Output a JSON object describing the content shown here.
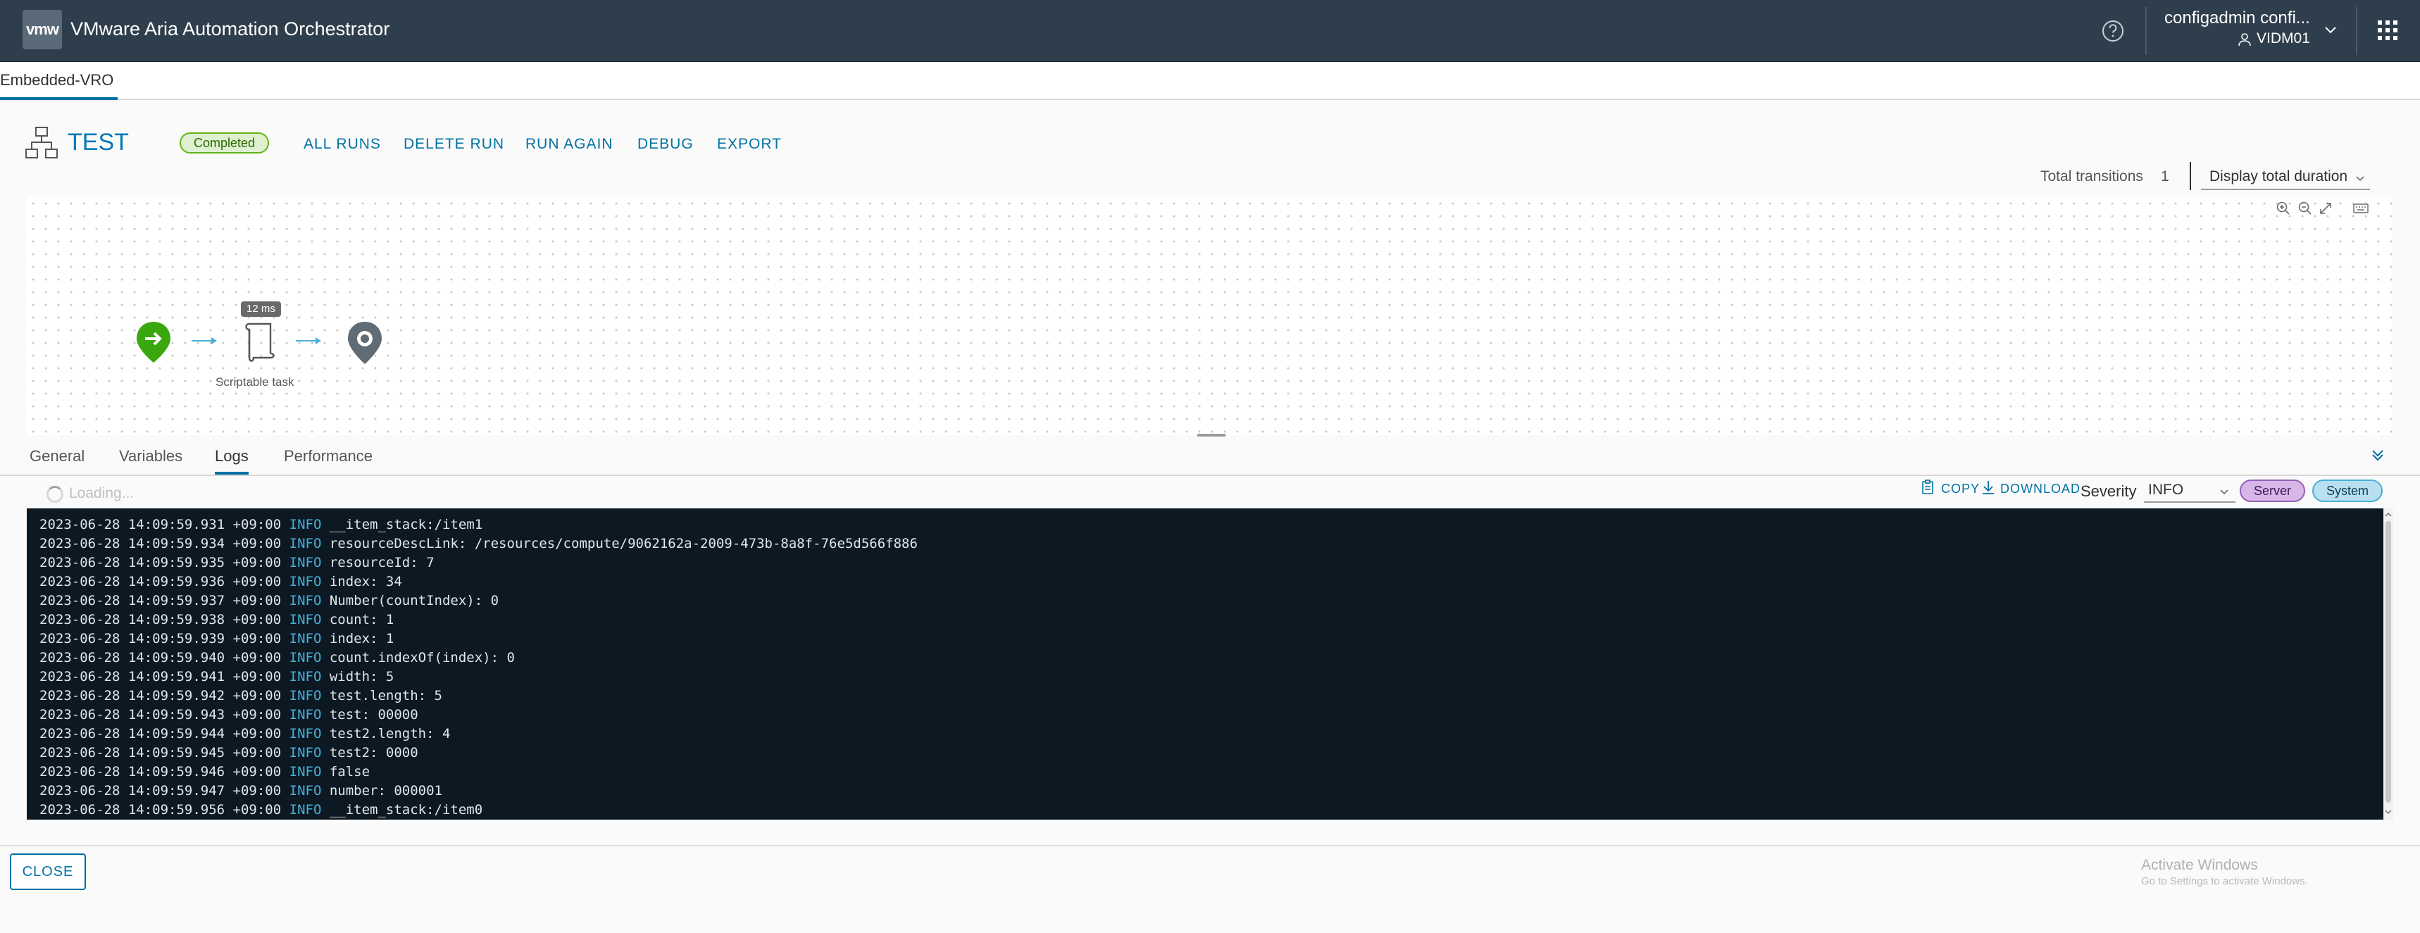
{
  "header": {
    "logo_text": "vmw",
    "app_title": "VMware Aria Automation Orchestrator",
    "user_name": "configadmin confi...",
    "tenant": "VIDM01",
    "icons": [
      "help-icon",
      "user-icon",
      "chevron-down-icon",
      "app-grid-icon"
    ]
  },
  "subnav": {
    "tab_label": "Embedded-VRO"
  },
  "workflow": {
    "title": "TEST",
    "status": "Completed",
    "status_color": "#60b515",
    "actions": [
      "ALL RUNS",
      "DELETE RUN",
      "RUN AGAIN",
      "DEBUG",
      "EXPORT"
    ]
  },
  "transitions": {
    "label": "Total transitions",
    "value": "1",
    "duration_option": "Display total duration"
  },
  "diagram": {
    "task_duration": "12 ms",
    "task_label": "Scriptable task",
    "tools": [
      "zoom-in-icon",
      "zoom-out-icon",
      "fit-screen-icon",
      "keyboard-icon"
    ]
  },
  "tabs": [
    {
      "label": "General",
      "active": false
    },
    {
      "label": "Variables",
      "active": false
    },
    {
      "label": "Logs",
      "active": true
    },
    {
      "label": "Performance",
      "active": false
    }
  ],
  "logs_toolbar": {
    "loading_text": "Loading...",
    "copy_label": "COPY",
    "download_label": "DOWNLOAD",
    "severity_label": "Severity",
    "severity_value": "INFO",
    "filter_server": "Server",
    "filter_system": "System"
  },
  "log_lines": [
    {
      "ts": "2023-06-28 14:09:59.931 +09:00",
      "level": "INFO",
      "msg": "__item_stack:/item1"
    },
    {
      "ts": "2023-06-28 14:09:59.934 +09:00",
      "level": "INFO",
      "msg": "resourceDescLink: /resources/compute/9062162a-2009-473b-8a8f-76e5d566f886"
    },
    {
      "ts": "2023-06-28 14:09:59.935 +09:00",
      "level": "INFO",
      "msg": "resourceId: 7"
    },
    {
      "ts": "2023-06-28 14:09:59.936 +09:00",
      "level": "INFO",
      "msg": "index: 34"
    },
    {
      "ts": "2023-06-28 14:09:59.937 +09:00",
      "level": "INFO",
      "msg": "Number(countIndex): 0"
    },
    {
      "ts": "2023-06-28 14:09:59.938 +09:00",
      "level": "INFO",
      "msg": "count: 1"
    },
    {
      "ts": "2023-06-28 14:09:59.939 +09:00",
      "level": "INFO",
      "msg": "index: 1"
    },
    {
      "ts": "2023-06-28 14:09:59.940 +09:00",
      "level": "INFO",
      "msg": "count.indexOf(index): 0"
    },
    {
      "ts": "2023-06-28 14:09:59.941 +09:00",
      "level": "INFO",
      "msg": "width: 5"
    },
    {
      "ts": "2023-06-28 14:09:59.942 +09:00",
      "level": "INFO",
      "msg": "test.length: 5"
    },
    {
      "ts": "2023-06-28 14:09:59.943 +09:00",
      "level": "INFO",
      "msg": "test: 00000"
    },
    {
      "ts": "2023-06-28 14:09:59.944 +09:00",
      "level": "INFO",
      "msg": "test2.length: 4"
    },
    {
      "ts": "2023-06-28 14:09:59.945 +09:00",
      "level": "INFO",
      "msg": "test2: 0000"
    },
    {
      "ts": "2023-06-28 14:09:59.946 +09:00",
      "level": "INFO",
      "msg": "false"
    },
    {
      "ts": "2023-06-28 14:09:59.947 +09:00",
      "level": "INFO",
      "msg": "number: 000001"
    },
    {
      "ts": "2023-06-28 14:09:59.956 +09:00",
      "level": "INFO",
      "msg": "__item_stack:/item0"
    }
  ],
  "footer": {
    "close_label": "CLOSE",
    "watermark_title": "Activate Windows",
    "watermark_sub": "Go to Settings to activate Windows."
  }
}
